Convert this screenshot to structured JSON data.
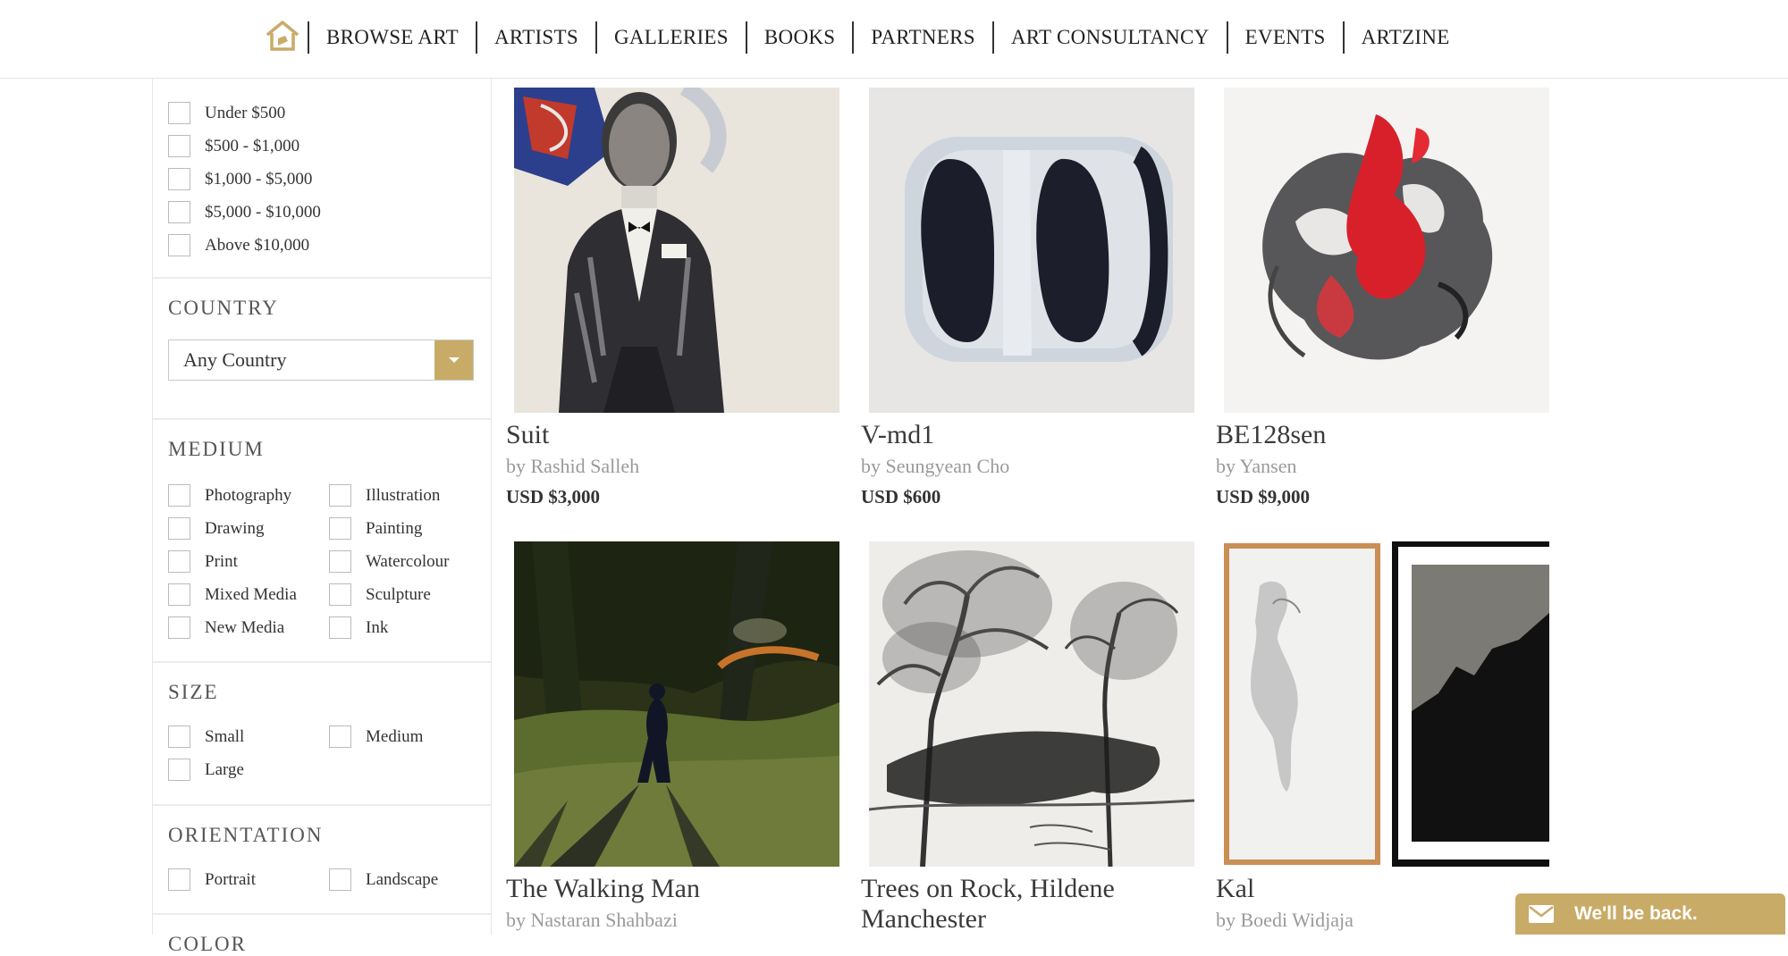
{
  "colors": {
    "accent": "#c9ab68",
    "text": "#333333",
    "muted": "#9a9a9a"
  },
  "nav": {
    "home_icon": "house-icon",
    "items": [
      "BROWSE ART",
      "ARTISTS",
      "GALLERIES",
      "BOOKS",
      "PARTNERS",
      "ART CONSULTANCY",
      "EVENTS",
      "ARTZINE"
    ]
  },
  "sidebar": {
    "price": {
      "options": [
        "Under $500",
        "$500 - $1,000",
        "$1,000 - $5,000",
        "$5,000 - $10,000",
        "Above $10,000"
      ]
    },
    "country": {
      "title": "COUNTRY",
      "selected": "Any Country"
    },
    "medium": {
      "title": "MEDIUM",
      "left": [
        "Photography",
        "Drawing",
        "Print",
        "Mixed Media",
        "New Media"
      ],
      "right": [
        "Illustration",
        "Painting",
        "Watercolour",
        "Sculpture",
        "Ink"
      ]
    },
    "size": {
      "title": "SIZE",
      "left": [
        "Small",
        "Large"
      ],
      "right": [
        "Medium"
      ]
    },
    "orientation": {
      "title": "ORIENTATION",
      "left": [
        "Portrait"
      ],
      "right": [
        "Landscape"
      ]
    },
    "color": {
      "title": "COLOR"
    }
  },
  "artworks": [
    {
      "title": "Suit",
      "artist": "by Rashid Salleh",
      "price": "USD $3,000"
    },
    {
      "title": "V-md1",
      "artist": "by Seungyean Cho",
      "price": "USD $600"
    },
    {
      "title": "BE128sen",
      "artist": "by Yansen",
      "price": "USD $9,000"
    },
    {
      "title": "The Walking Man",
      "artist": "by Nastaran Shahbazi"
    },
    {
      "title": "Trees on Rock, Hildene",
      "title2": "Manchester"
    },
    {
      "title": "Kal",
      "artist": "by Boedi Widjaja"
    }
  ],
  "chat": {
    "label": "We'll be back.",
    "icon": "envelope-icon"
  }
}
